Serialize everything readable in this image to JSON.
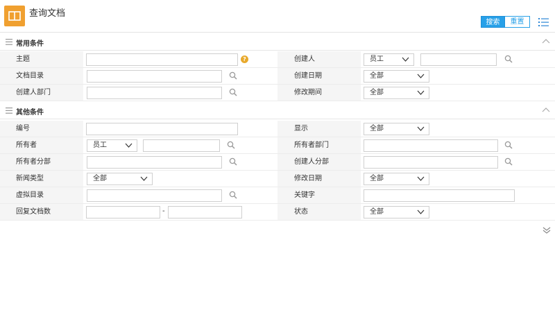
{
  "header": {
    "title": "查询文档",
    "logo_icon": "book-icon",
    "search_label": "搜索",
    "reset_label": "重置",
    "accent": "#27a0e8",
    "logo_color": "#f0a030"
  },
  "sections": {
    "common": "常用条件",
    "other": "其他条件"
  },
  "common": {
    "subject_label": "主题",
    "creator_label": "创建人",
    "creator_type": "员工",
    "doc_dir_label": "文档目录",
    "create_date_label": "创建日期",
    "create_date_value": "全部",
    "creator_dept_label": "创建人部门",
    "modify_period_label": "修改期间",
    "modify_period_value": "全部"
  },
  "other": {
    "number_label": "编号",
    "display_label": "显示",
    "display_value": "全部",
    "owner_label": "所有者",
    "owner_type": "员工",
    "owner_dept_label": "所有者部门",
    "owner_branch_label": "所有者分部",
    "creator_branch_label": "创建人分部",
    "news_type_label": "新闻类型",
    "news_type_value": "全部",
    "modify_date_label": "修改日期",
    "modify_date_value": "全部",
    "virtual_dir_label": "虚拟目录",
    "keyword_label": "关键字",
    "reply_count_label": "回复文档数",
    "range_dash": "-",
    "status_label": "状态",
    "status_value": "全部"
  }
}
